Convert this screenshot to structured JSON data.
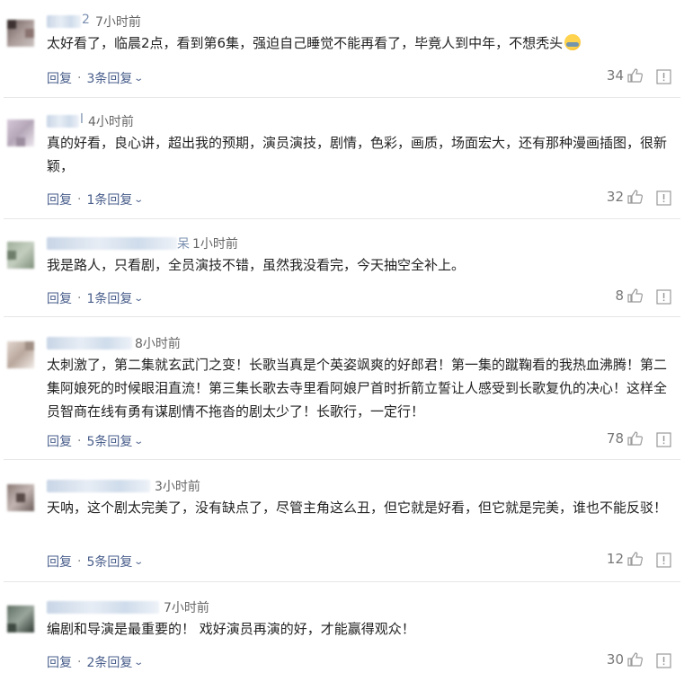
{
  "colors": {
    "link": "#4a5f8c",
    "meta": "#777777",
    "divider": "#e7e7e7"
  },
  "comments": [
    {
      "time": "7小时前",
      "username_tail": "2",
      "text": "太好看了，临晨2点，看到第6集，强迫自己睡觉不能再看了，毕竟人到中年，不想秃头",
      "emoji": "crying-laugh-emoji",
      "reply_label": "回复",
      "replies_label": "3条回复",
      "likes": "34"
    },
    {
      "time": "4小时前",
      "username_tail": "l",
      "text": "真的好看，良心讲，超出我的预期，演员演技，剧情，色彩，画质，场面宏大，还有那种漫画插图，很新颖，",
      "reply_label": "回复",
      "replies_label": "1条回复",
      "likes": "32"
    },
    {
      "time": "1小时前",
      "username_tail": "呆",
      "text": "我是路人，只看剧，全员演技不错，虽然我没看完，今天抽空全补上。",
      "reply_label": "回复",
      "replies_label": "1条回复",
      "likes": "8"
    },
    {
      "time": "8小时前",
      "username_tail": "",
      "text": "太刺激了，第二集就玄武门之变！长歌当真是个英姿飒爽的好郎君！第一集的蹴鞠看的我热血沸腾！第二集阿娘死的时候眼泪直流！第三集长歌去寺里看阿娘尸首时折箭立誓让人感受到长歌复仇的决心！这样全员智商在线有勇有谋剧情不拖沓的剧太少了！长歌行，一定行！",
      "reply_label": "回复",
      "replies_label": "5条回复",
      "likes": "78"
    },
    {
      "time": "3小时前",
      "username_tail": "",
      "text": "天呐，这个剧太完美了，没有缺点了，尽管主角这么丑，但它就是好看，但它就是完美，谁也不能反驳！",
      "reply_label": "回复",
      "replies_label": "5条回复",
      "likes": "12"
    },
    {
      "time": "7小时前",
      "username_tail": "",
      "text": "编剧和导演是最重要的！ 戏好演员再演的好，才能赢得观众！",
      "reply_label": "回复",
      "replies_label": "2条回复",
      "likes": "30"
    }
  ]
}
